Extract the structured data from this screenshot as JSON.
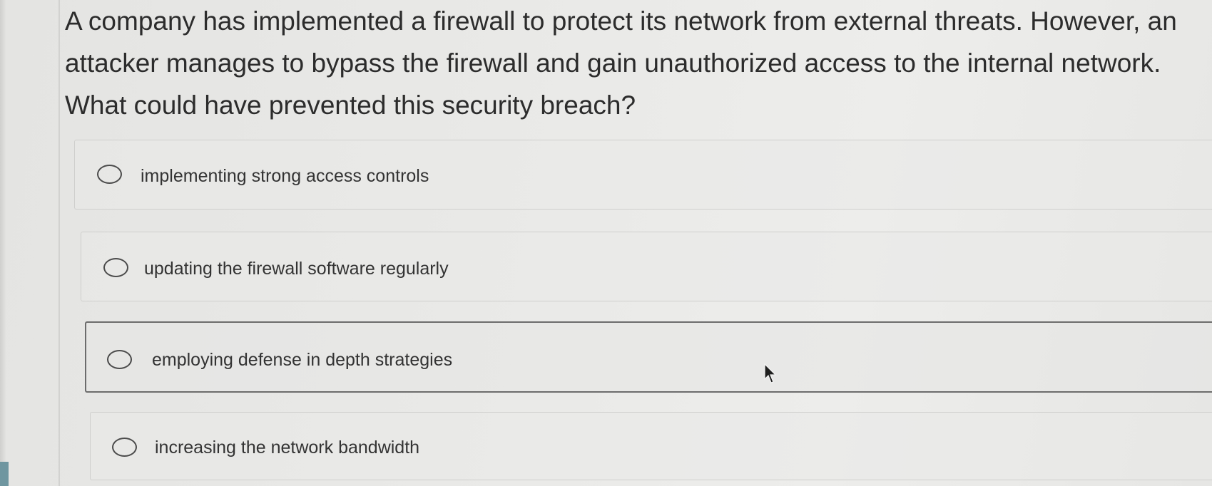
{
  "question": {
    "lines": [
      "A company has implemented a firewall to protect its network from external threats. However, an",
      "attacker manages to bypass the firewall and gain unauthorized access to the internal network.",
      "What could have prevented this security breach?"
    ]
  },
  "options": [
    {
      "label": "implementing strong access controls",
      "selected": false
    },
    {
      "label": "updating the firewall software regularly",
      "selected": false
    },
    {
      "label": "employing defense in depth strategies",
      "selected": false
    },
    {
      "label": "increasing the network bandwidth",
      "selected": false
    }
  ],
  "colors": {
    "background": "#e9e9e7",
    "text": "#2c2c2c",
    "option_border": "#cfcfcd",
    "focused_border": "#6c6c6c",
    "left_marker": "#6f96a0"
  },
  "icons": {
    "radio": "radio-button-empty-icon",
    "pointer": "mouse-pointer-icon"
  }
}
